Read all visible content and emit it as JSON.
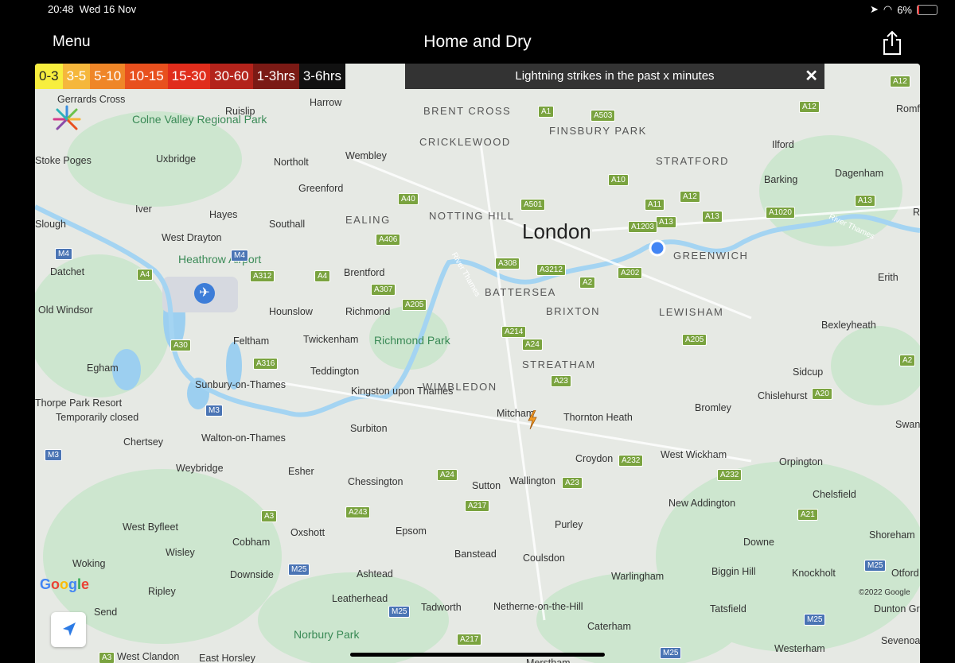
{
  "status": {
    "time": "20:48",
    "date": "Wed 16 Nov",
    "battery": "6%"
  },
  "nav": {
    "menu": "Menu",
    "title": "Home and Dry"
  },
  "legend": [
    {
      "label": "0-3",
      "color": "#f7ee3e",
      "text": "#222"
    },
    {
      "label": "3-5",
      "color": "#f5b73c",
      "text": "#fff"
    },
    {
      "label": "5-10",
      "color": "#ef8628",
      "text": "#fff"
    },
    {
      "label": "10-15",
      "color": "#e8501e",
      "text": "#fff"
    },
    {
      "label": "15-30",
      "color": "#e02d1c",
      "text": "#fff"
    },
    {
      "label": "30-60",
      "color": "#b3231b",
      "text": "#fff"
    },
    {
      "label": "1-3hrs",
      "color": "#7b1a15",
      "text": "#fff"
    },
    {
      "label": "3-6hrs",
      "color": "#111111",
      "text": "#fff"
    }
  ],
  "banner": {
    "text": "Lightning strikes in the past x minutes",
    "close": "✕"
  },
  "map": {
    "places": [
      "Gerrards Cross",
      "Ruislip",
      "Harrow",
      "BRENT CROSS",
      "FINSBURY PARK",
      "Romford",
      "Colne Valley Regional Park",
      "CRICKLEWOOD",
      "Ilford",
      "Stoke Poges",
      "Uxbridge",
      "Northolt",
      "Wembley",
      "STRATFORD",
      "Dagenham",
      "Barking",
      "Greenford",
      "Iver",
      "Hayes",
      "EALING",
      "NOTTING HILL",
      "London",
      "Slough",
      "Southall",
      "West Drayton",
      "GREENWICH",
      "Rainham",
      "Heathrow Airport",
      "Datchet",
      "Brentford",
      "BATTERSEA",
      "Erith",
      "Old Windsor",
      "Hounslow",
      "Richmond",
      "BRIXTON",
      "LEWISHAM",
      "Bexleyheath",
      "Feltham",
      "Twickenham",
      "Richmond Park",
      "Egham",
      "Teddington",
      "STREATHAM",
      "Sidcup",
      "Sunbury-on-Thames",
      "Kingston upon Thames",
      "WIMBLEDON",
      "Chislehurst",
      "Bromley",
      "Thorpe Park Resort",
      "Temporarily closed",
      "Mitcham",
      "Thornton Heath",
      "Surbiton",
      "Chertsey",
      "Walton-on-Thames",
      "Croydon",
      "West Wickham",
      "Swanley",
      "Weybridge",
      "Esher",
      "Chessington",
      "Sutton",
      "Wallington",
      "Orpington",
      "Cobham",
      "Chelsfield",
      "New Addington",
      "West Byfleet",
      "Oxshott",
      "Epsom",
      "Purley",
      "Shoreham",
      "Downe",
      "Wisley",
      "Banstead",
      "Coulsdon",
      "Woking",
      "Downside",
      "Ashtead",
      "Warlingham",
      "Biggin Hill",
      "Knockholt",
      "Otford",
      "Ripley",
      "Leatherhead",
      "Send",
      "Tadworth",
      "Netherne-on-the-Hill",
      "Caterham",
      "Tatsfield",
      "Dunton Green",
      "Norbury Park",
      "Westerham",
      "Sevenoaks",
      "West Clandon",
      "East Horsley",
      "Merstham"
    ],
    "rivers": [
      "River Thames",
      "River Thames"
    ],
    "roads": [
      "A12",
      "A12",
      "A1",
      "A503",
      "A10",
      "A40",
      "A501",
      "A11",
      "A12",
      "A13",
      "A1020",
      "A13",
      "A1203",
      "A13",
      "A406",
      "A308",
      "A3212",
      "A2",
      "A202",
      "A312",
      "A4",
      "A4",
      "A307",
      "A205",
      "A214",
      "A24",
      "A205",
      "A30",
      "A316",
      "A23",
      "A20",
      "A2",
      "A232",
      "A24",
      "A217",
      "A23",
      "A232",
      "A243",
      "A3",
      "A21",
      "A3",
      "A217"
    ],
    "motorways": [
      "M4",
      "M4",
      "M3",
      "M3",
      "M25",
      "M25",
      "M25",
      "M25",
      "M25"
    ],
    "attribution": "©2022 Google",
    "google_logo": "Google"
  }
}
